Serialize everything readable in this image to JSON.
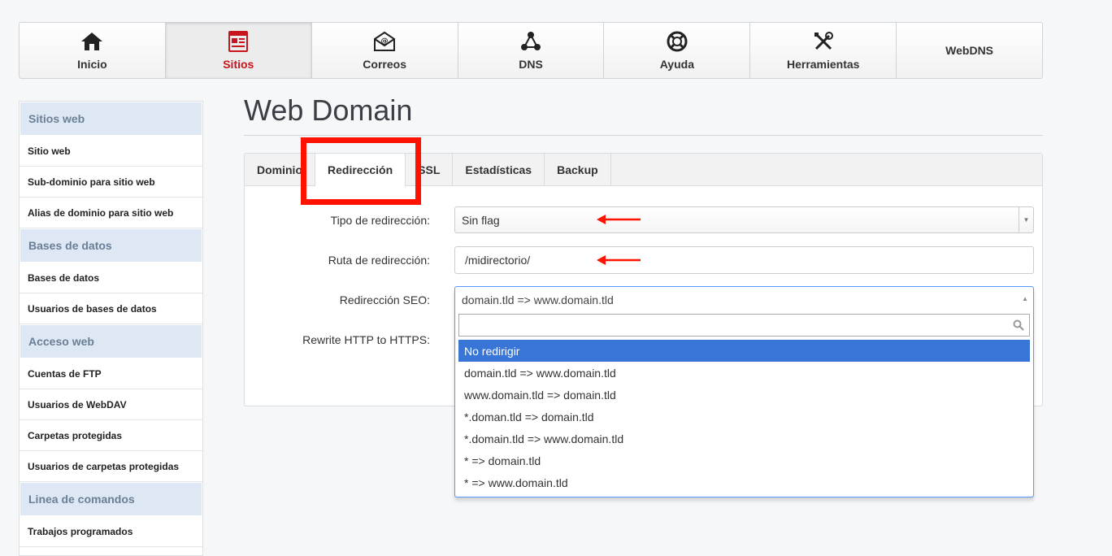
{
  "nav": {
    "items": [
      {
        "label": "Inicio",
        "icon": "home-icon"
      },
      {
        "label": "Sitios",
        "icon": "sites-icon",
        "active": true
      },
      {
        "label": "Correos",
        "icon": "mail-icon"
      },
      {
        "label": "DNS",
        "icon": "dns-icon"
      },
      {
        "label": "Ayuda",
        "icon": "help-icon"
      },
      {
        "label": "Herramientas",
        "icon": "tools-icon"
      },
      {
        "label": "WebDNS"
      }
    ]
  },
  "sidebar": {
    "sections": [
      {
        "header": "Sitios web",
        "items": [
          "Sitio web",
          "Sub-dominio para sitio web",
          "Alias de dominio para sitio web"
        ]
      },
      {
        "header": "Bases de datos",
        "items": [
          "Bases de datos",
          "Usuarios de bases de datos"
        ]
      },
      {
        "header": "Acceso web",
        "items": [
          "Cuentas de FTP",
          "Usuarios de WebDAV",
          "Carpetas protegidas",
          "Usuarios de carpetas protegidas"
        ]
      },
      {
        "header": "Linea de comandos",
        "items": [
          "Trabajos programados"
        ]
      }
    ]
  },
  "page": {
    "title": "Web Domain"
  },
  "tabs": [
    "Dominio",
    "Redirección",
    "SSL",
    "Estadísticas",
    "Backup"
  ],
  "form": {
    "redirect_type_label": "Tipo de redirección:",
    "redirect_type_value": "Sin flag",
    "redirect_path_label": "Ruta de redirección:",
    "redirect_path_value": "/midirectorio/",
    "seo_label": "Redirección SEO:",
    "seo_value": "domain.tld => www.domain.tld",
    "rewrite_label": "Rewrite HTTP to HTTPS:"
  },
  "dropdown": {
    "options": [
      "No redirigir",
      "domain.tld => www.domain.tld",
      "www.domain.tld => domain.tld",
      "*.doman.tld => domain.tld",
      "*.domain.tld => www.domain.tld",
      "* => domain.tld",
      "* => www.domain.tld"
    ],
    "highlighted_index": 0
  },
  "colors": {
    "accent": "#c7141e",
    "highlight": "#3875d7",
    "annotation": "#ff1200",
    "sidebar_header_bg": "#dde8f4"
  }
}
